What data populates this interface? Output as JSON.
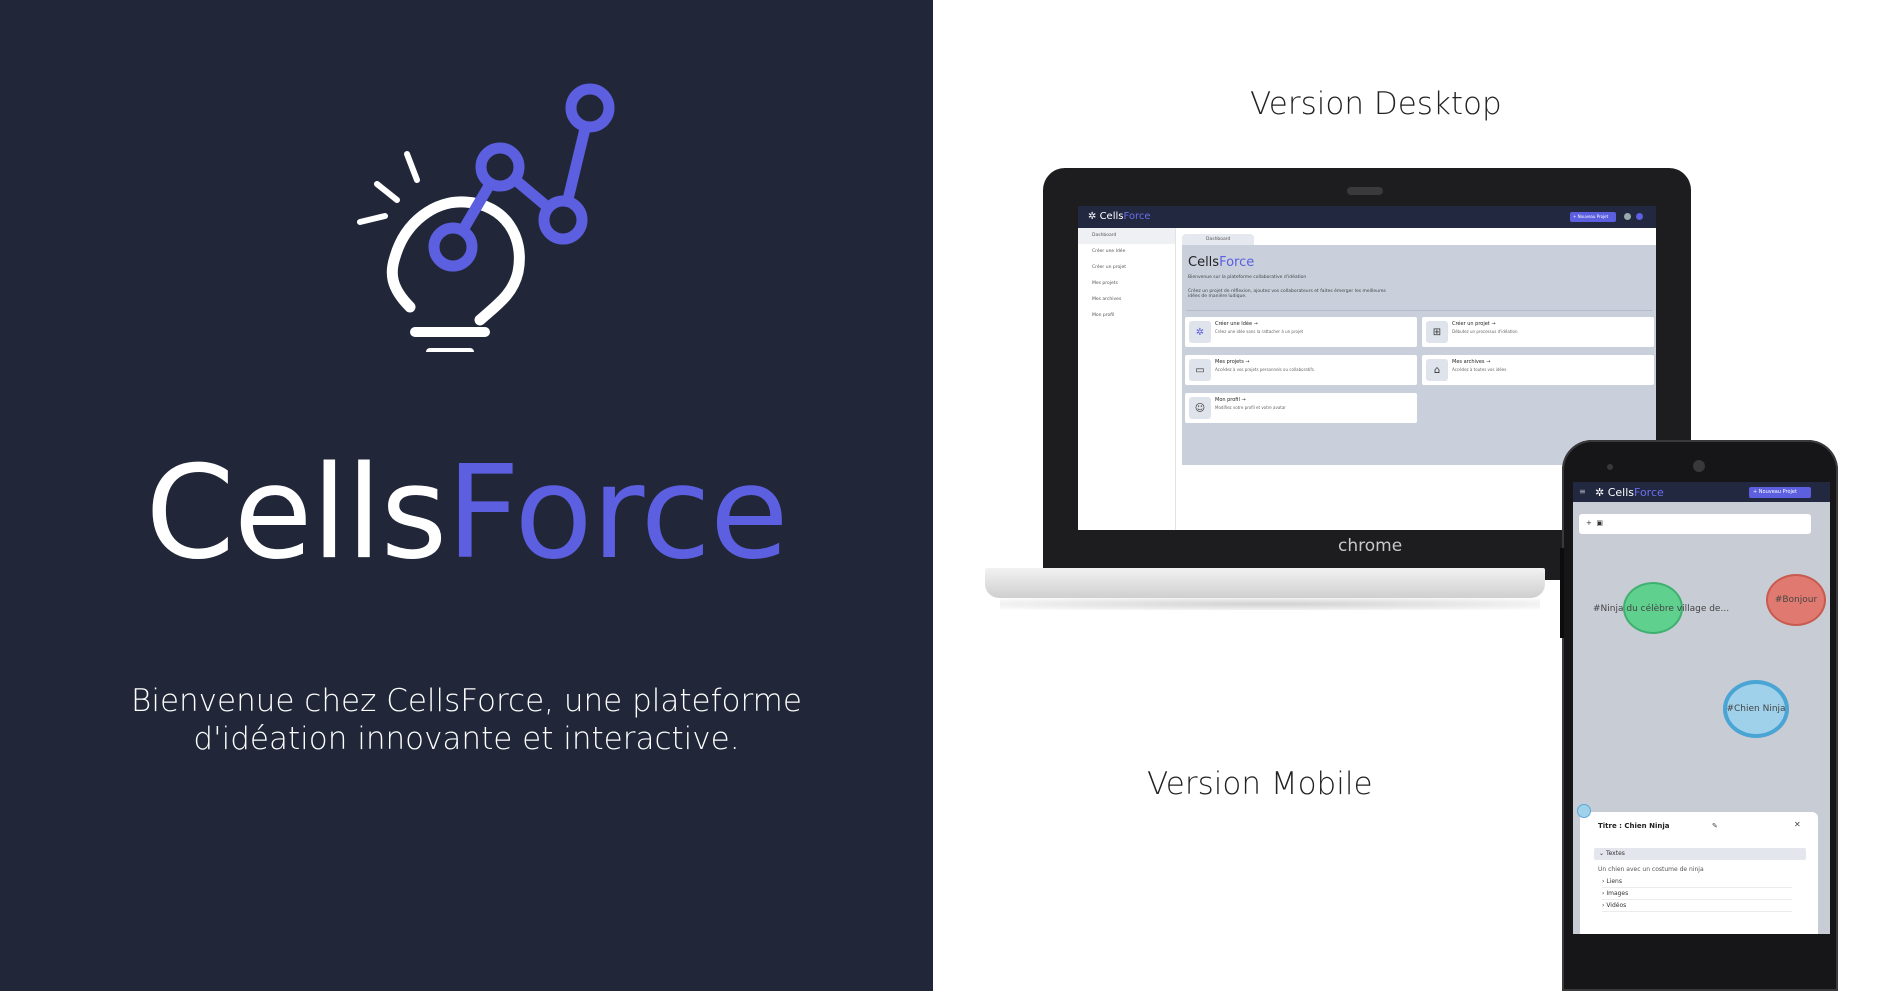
{
  "colors": {
    "dark_bg": "#212738",
    "accent": "#5b5fe0",
    "white": "#ffffff"
  },
  "hero": {
    "logo_icon": "lightbulb-network-icon",
    "brand_part1": "Cells",
    "brand_part2": "Force",
    "tagline_line1": "Bienvenue chez CellsForce, une plateforme",
    "tagline_line2": "d'idéation innovante et interactive."
  },
  "labels": {
    "desktop": "Version Desktop",
    "mobile": "Version Mobile",
    "chrome": "chrome"
  },
  "desktop_app": {
    "logo_part1": "Cells",
    "logo_part2": "Force",
    "new_project": "+ Nouveau Projet",
    "sidebar": [
      {
        "label": "Dashboard"
      },
      {
        "label": "Créer une Idée"
      },
      {
        "label": "Créer un projet"
      },
      {
        "label": "Mes projets"
      },
      {
        "label": "Mes archives"
      },
      {
        "label": "Mon profil"
      }
    ],
    "tab": "Dashboard",
    "heading_part1": "Cells",
    "heading_part2": "Force",
    "welcome": "Bienvenue sur la plateforme collaborative d'idéation",
    "intro": "Créez un projet de réflexion, ajoutez vos collaborateurs et faites émerger les meilleures idées de manière ludique.",
    "cards": [
      {
        "title": "Créer une Idée →",
        "desc": "Créez une idée sans la rattacher à un projet"
      },
      {
        "title": "Créer un projet →",
        "desc": "Débutez un processus d'idéation"
      },
      {
        "title": "Mes projets →",
        "desc": "Accédez à vos projets personnels ou collaboratifs."
      },
      {
        "title": "Mes archives →",
        "desc": "Accédez à toutes vos idées"
      },
      {
        "title": "Mon profil →",
        "desc": "Modifiez votre profil et votre avatar"
      }
    ]
  },
  "mobile_app": {
    "logo_part1": "Cells",
    "logo_part2": "Force",
    "new_project": "+ Nouveau Projet",
    "bubbles": [
      {
        "label": "#Ninja du célèbre village de...",
        "color": "#5fd08e"
      },
      {
        "label": "#Bonjour",
        "color": "#e07a70"
      },
      {
        "label": "#Chien Ninja",
        "color": "#9fd1ea"
      }
    ],
    "detail_title": "Titre : Chien Ninja",
    "section_textes": "Textes",
    "detail_desc": "Un chien avec un costume de ninja",
    "links": [
      "Liens",
      "Images",
      "Vidéos"
    ]
  }
}
